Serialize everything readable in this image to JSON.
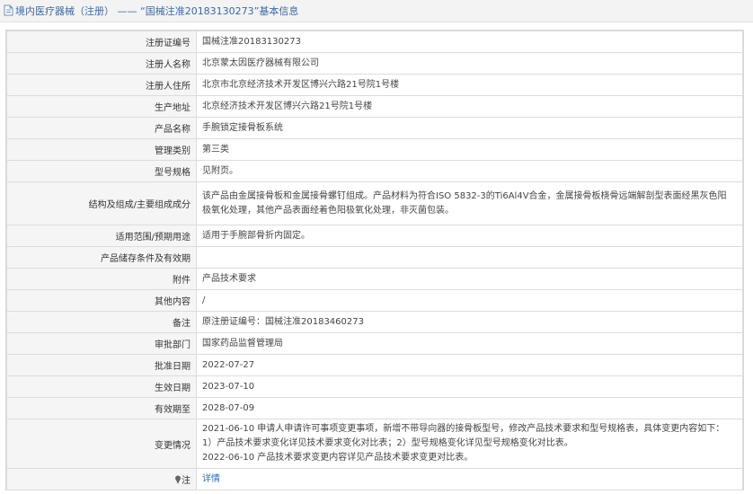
{
  "header": {
    "title": "境内医疗器械（注册） —— “国械注准20183130273”基本信息"
  },
  "rows": [
    {
      "label": "注册证编号",
      "value": "国械注准20183130273"
    },
    {
      "label": "注册人名称",
      "value": "北京蒙太因医疗器械有限公司"
    },
    {
      "label": "注册人住所",
      "value": "北京市北京经济技术开发区博兴六路21号院1号楼"
    },
    {
      "label": "生产地址",
      "value": "北京经济技术开发区博兴六路21号院1号楼"
    },
    {
      "label": "产品名称",
      "value": "手腕锁定接骨板系统"
    },
    {
      "label": "管理类别",
      "value": "第三类"
    },
    {
      "label": "型号规格",
      "value": "见附页。"
    },
    {
      "label": "结构及组成/主要组成成分",
      "value_lines": [
        "该产品由金属接骨板和金属接骨螺钉组成。产品材料为符合ISO 5832-3的Ti6Al4V合金，金属接骨板桡骨远端解剖型表面经黑灰色阳",
        "极氧化处理，其他产品表面经着色阳极氧化处理，非灭菌包装。"
      ]
    },
    {
      "label": "适用范围/预期用途",
      "value": "适用于手腕部骨折内固定。"
    },
    {
      "label": "产品储存条件及有效期",
      "value": ""
    },
    {
      "label": "附件",
      "value": "产品技术要求"
    },
    {
      "label": "其他内容",
      "value": "/"
    },
    {
      "label": "备注",
      "value": "原注册证编号：国械注准20183460273"
    },
    {
      "label": "审批部门",
      "value": "国家药品监督管理局"
    },
    {
      "label": "批准日期",
      "value": "2022-07-27"
    },
    {
      "label": "生效日期",
      "value": "2023-07-10"
    },
    {
      "label": "有效期至",
      "value": "2028-07-09"
    },
    {
      "label": "变更情况",
      "value_lines": [
        "2021-06-10 申请人申请许可事项变更事项，新增不带导向器的接骨板型号，修改产品技术要求和型号规格表，具体变更内容如下：",
        "1）产品技术要求变化详见技术要求变化对比表；2）型号规格变化详见型号规格变化对比表。",
        "2022-06-10 产品技术要求变更内容详见产品技术要求变更对比表。"
      ]
    },
    {
      "label": "注",
      "value": "详情"
    }
  ]
}
